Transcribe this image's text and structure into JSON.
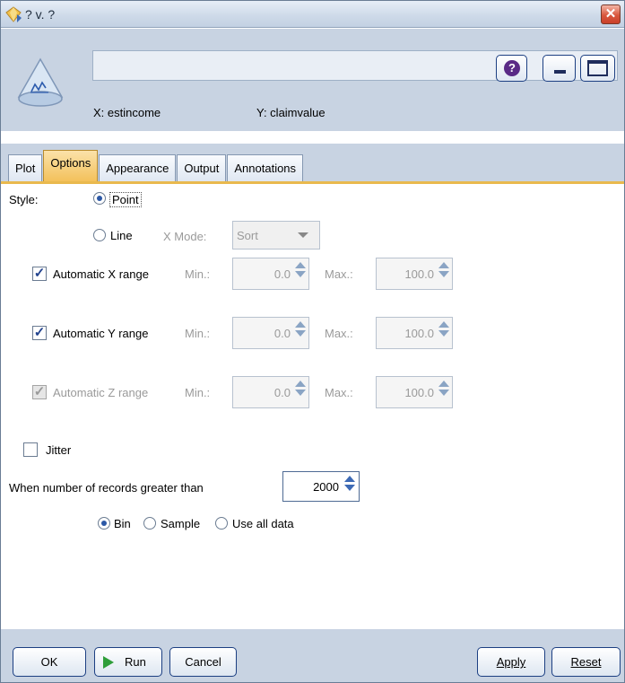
{
  "window": {
    "title": "? v. ?"
  },
  "header": {
    "node_name": "",
    "x_label": "X: estincome",
    "y_label": "Y: claimvalue",
    "help_label": "?"
  },
  "tabs": [
    {
      "label": "Plot",
      "active": false
    },
    {
      "label": "Options",
      "active": true
    },
    {
      "label": "Appearance",
      "active": false
    },
    {
      "label": "Output",
      "active": false
    },
    {
      "label": "Annotations",
      "active": false
    }
  ],
  "options": {
    "style_label": "Style:",
    "point_label": "Point",
    "line_label": "Line",
    "style_selected": "Point",
    "x_mode_label": "X Mode:",
    "x_mode_value": "Sort",
    "ranges": [
      {
        "label": "Automatic X range",
        "checked": true,
        "enabled": true,
        "min_label": "Min.:",
        "min": "0.0",
        "max_label": "Max.:",
        "max": "100.0"
      },
      {
        "label": "Automatic Y range",
        "checked": true,
        "enabled": true,
        "min_label": "Min.:",
        "min": "0.0",
        "max_label": "Max.:",
        "max": "100.0"
      },
      {
        "label": "Automatic Z range",
        "checked": true,
        "enabled": false,
        "min_label": "Min.:",
        "min": "0.0",
        "max_label": "Max.:",
        "max": "100.0"
      }
    ],
    "jitter_label": "Jitter",
    "jitter_checked": false,
    "records_label": "When number of records greater than",
    "records_value": "2000",
    "sampling": [
      {
        "label": "Bin",
        "selected": true
      },
      {
        "label": "Sample",
        "selected": false
      },
      {
        "label": "Use all data",
        "selected": false
      }
    ]
  },
  "footer": {
    "ok": "OK",
    "run": "Run",
    "cancel": "Cancel",
    "apply": "Apply",
    "reset": "Reset"
  },
  "colors": {
    "chrome": "#c8d3e2",
    "active_tab": "#f3c15b",
    "accent_blue": "#2c58a6"
  }
}
